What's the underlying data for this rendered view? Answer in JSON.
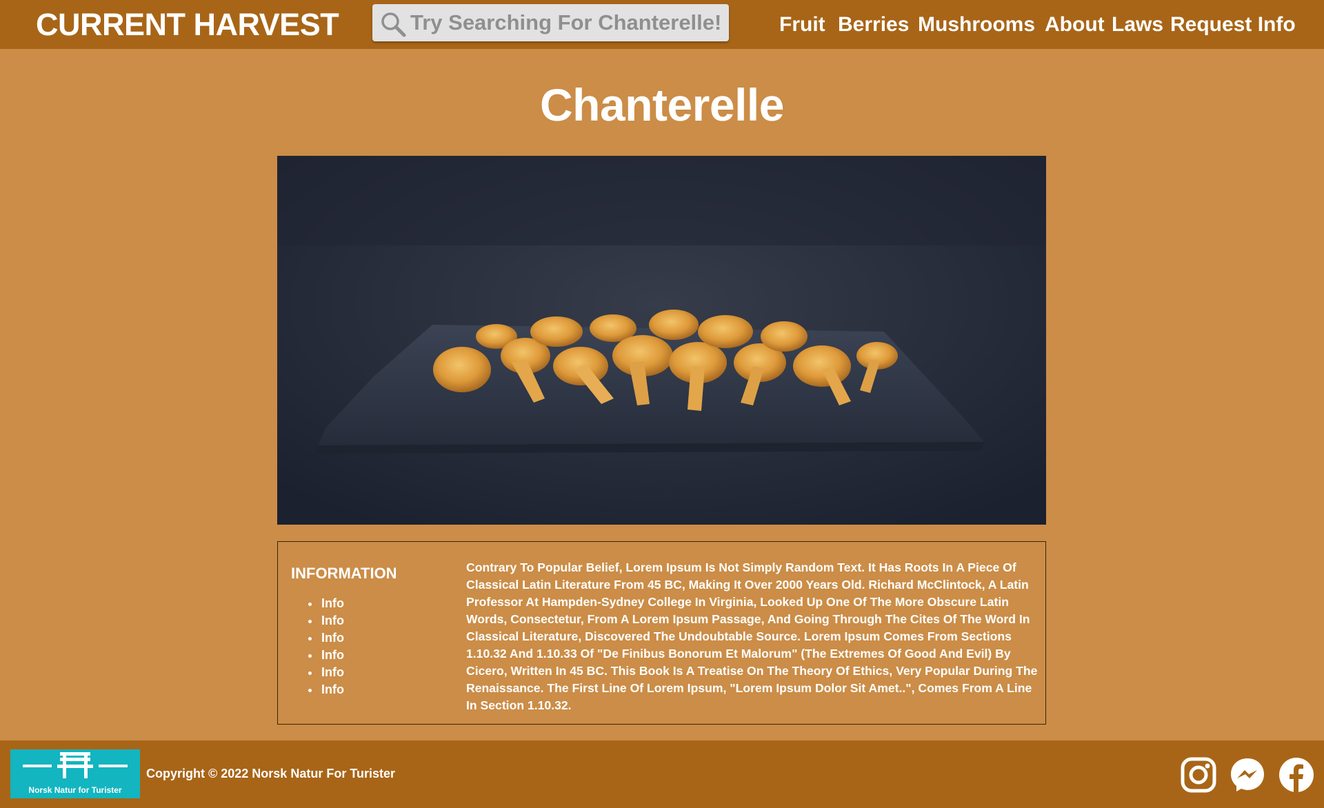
{
  "header": {
    "brand": "CURRENT HARVEST",
    "search_placeholder": "Try Searching For Chanterelle!",
    "nav": [
      {
        "label": "Fruit"
      },
      {
        "label": "Berries"
      },
      {
        "label": "Mushrooms"
      },
      {
        "label": "About"
      },
      {
        "label": "Laws"
      },
      {
        "label": "Request Info"
      }
    ]
  },
  "main": {
    "title": "Chanterelle",
    "image_alt": "Chanterelle mushrooms on a dark cloth",
    "info": {
      "heading": "INFORMATION",
      "items": [
        "Info",
        "Info",
        "Info",
        "Info",
        "Info",
        "Info"
      ],
      "text": "Contrary To Popular Belief, Lorem Ipsum Is Not Simply Random Text. It Has Roots In A Piece Of Classical Latin Literature From 45 BC, Making It Over 2000 Years Old. Richard McClintock, A Latin Professor At Hampden-Sydney College In Virginia, Looked Up One Of The More Obscure Latin Words, Consectetur, From A Lorem Ipsum Passage, And Going Through The Cites Of The Word In Classical Literature, Discovered The Undoubtable Source. Lorem Ipsum Comes From Sections 1.10.32 And 1.10.33 Of \"De Finibus Bonorum Et Malorum\" (The Extremes Of Good And Evil) By Cicero, Written In 45 BC. This Book Is A Treatise On The Theory Of Ethics, Very Popular During The Renaissance. The First Line Of Lorem Ipsum, \"Lorem Ipsum Dolor Sit Amet..\", Comes From A Line In Section 1.10.32."
    }
  },
  "footer": {
    "logo_text": "Norsk Natur for Turister",
    "copyright": "Copyright © 2022 Norsk Natur For Turister",
    "social": [
      {
        "icon": "instagram-icon"
      },
      {
        "icon": "messenger-icon"
      },
      {
        "icon": "facebook-icon"
      }
    ]
  },
  "colors": {
    "header_bg": "#A86517",
    "page_bg": "#CB8D47",
    "logo_bg": "#12B5C0",
    "text": "#FFFFFF"
  }
}
